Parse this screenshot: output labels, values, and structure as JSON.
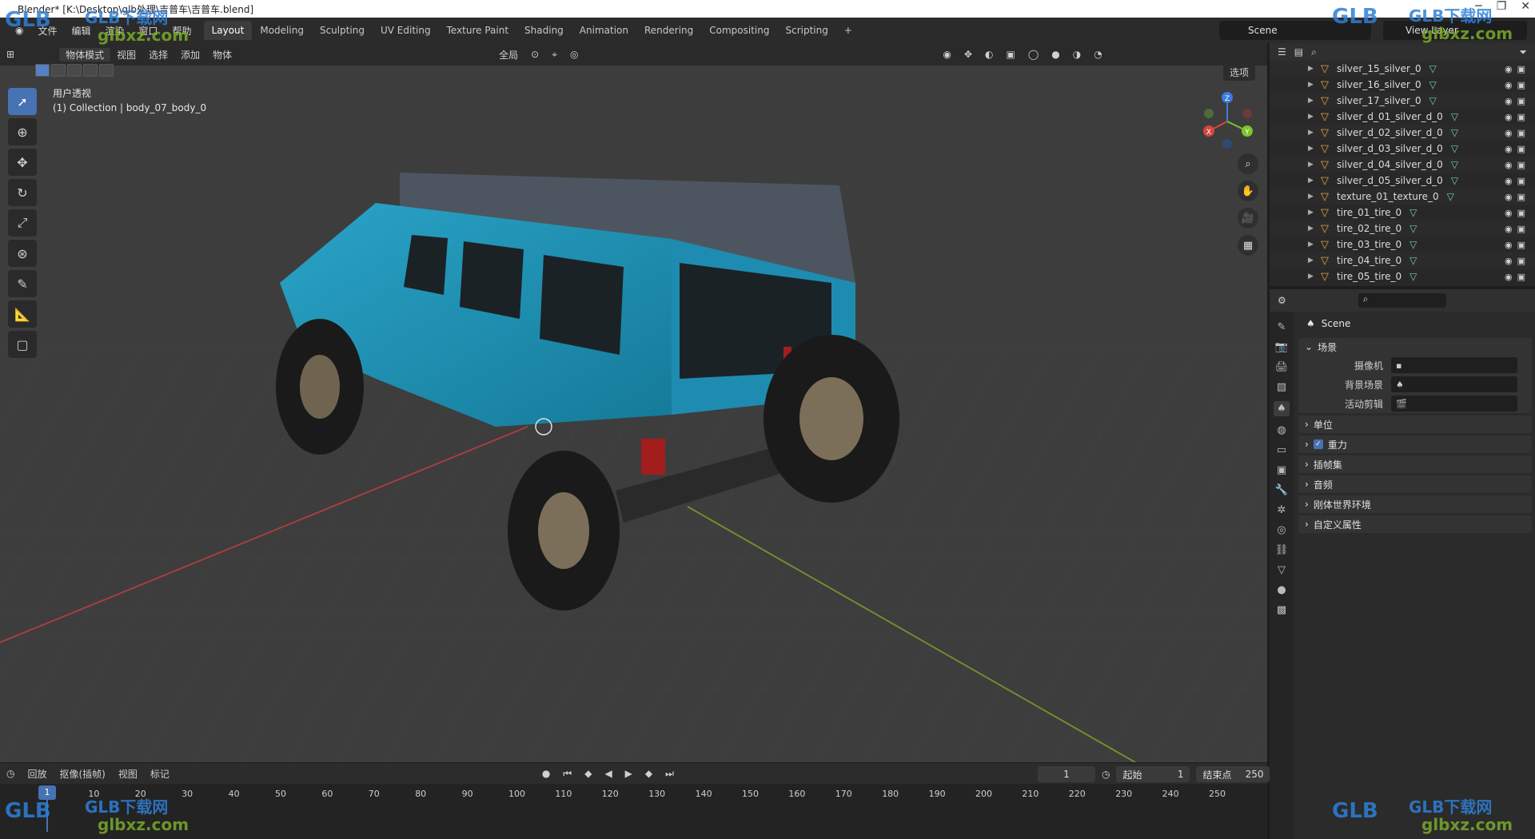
{
  "window": {
    "title": "Blender* [K:\\Desktop\\glb处理\\吉普车\\吉普车.blend]"
  },
  "menu": [
    "文件",
    "编辑",
    "渲染",
    "窗口",
    "帮助"
  ],
  "workspaces": [
    "Layout",
    "Modeling",
    "Sculpting",
    "UV Editing",
    "Texture Paint",
    "Shading",
    "Animation",
    "Rendering",
    "Compositing",
    "Scripting",
    "+"
  ],
  "scene_name": "Scene",
  "view_layer": "View Layer",
  "viewport": {
    "mode": "物体模式",
    "menus": [
      "视图",
      "选择",
      "添加",
      "物体"
    ],
    "transform": "全局",
    "options": "选项",
    "info_line1": "用户透视",
    "info_line2": "(1) Collection | body_07_body_0"
  },
  "gizmo": {
    "x": "X",
    "y": "Y",
    "z": "Z"
  },
  "outliner": [
    {
      "name": "silver_15_silver_0"
    },
    {
      "name": "silver_16_silver_0"
    },
    {
      "name": "silver_17_silver_0"
    },
    {
      "name": "silver_d_01_silver_d_0"
    },
    {
      "name": "silver_d_02_silver_d_0"
    },
    {
      "name": "silver_d_03_silver_d_0"
    },
    {
      "name": "silver_d_04_silver_d_0"
    },
    {
      "name": "silver_d_05_silver_d_0"
    },
    {
      "name": "texture_01_texture_0"
    },
    {
      "name": "tire_01_tire_0"
    },
    {
      "name": "tire_02_tire_0"
    },
    {
      "name": "tire_03_tire_0"
    },
    {
      "name": "tire_04_tire_0"
    },
    {
      "name": "tire_05_tire_0"
    }
  ],
  "properties": {
    "title": "Scene",
    "scene_panel": "场景",
    "camera_label": "摄像机",
    "bg_scene_label": "背景场景",
    "active_clip_label": "活动剪辑",
    "panels": [
      "单位",
      "重力",
      "插帧集",
      "音频",
      "刚体世界环境",
      "自定义属性"
    ]
  },
  "timeline": {
    "menus": [
      "回放",
      "抠像(插帧)",
      "视图",
      "标记"
    ],
    "current_frame": "1",
    "start_label": "起始",
    "start": "1",
    "end_label": "结束点",
    "end": "250",
    "ticks": [
      "1",
      "10",
      "20",
      "30",
      "40",
      "50",
      "60",
      "70",
      "80",
      "90",
      "100",
      "110",
      "120",
      "130",
      "140",
      "150",
      "160",
      "170",
      "180",
      "190",
      "200",
      "210",
      "220",
      "230",
      "240",
      "250"
    ]
  },
  "watermark": {
    "brand": "GLB下载网",
    "site": "glbxz.com",
    "logo": "GLB"
  }
}
